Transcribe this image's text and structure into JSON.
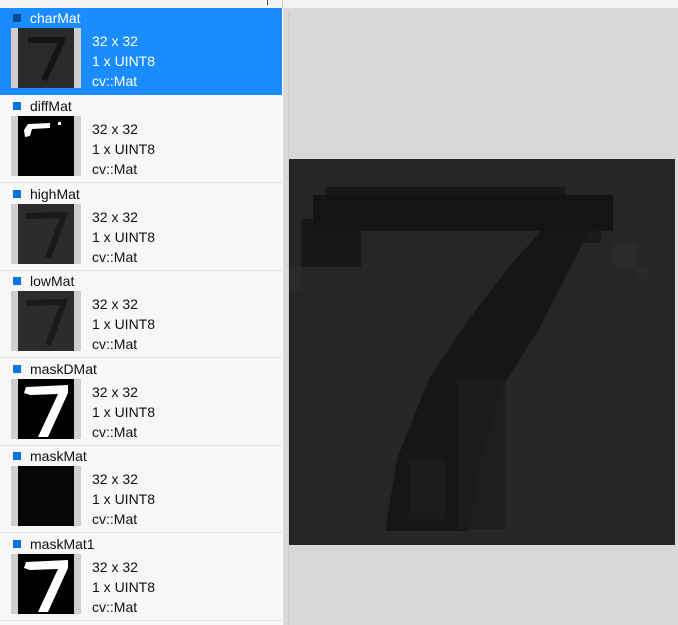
{
  "mats": [
    {
      "name": "charMat",
      "size": "32 x 32",
      "format": "1 x UINT8",
      "type": "cv::Mat",
      "selected": true
    },
    {
      "name": "diffMat",
      "size": "32 x 32",
      "format": "1 x UINT8",
      "type": "cv::Mat",
      "selected": false
    },
    {
      "name": "highMat",
      "size": "32 x 32",
      "format": "1 x UINT8",
      "type": "cv::Mat",
      "selected": false
    },
    {
      "name": "lowMat",
      "size": "32 x 32",
      "format": "1 x UINT8",
      "type": "cv::Mat",
      "selected": false
    },
    {
      "name": "maskDMat",
      "size": "32 x 32",
      "format": "1 x UINT8",
      "type": "cv::Mat",
      "selected": false
    },
    {
      "name": "maskMat",
      "size": "32 x 32",
      "format": "1 x UINT8",
      "type": "cv::Mat",
      "selected": false
    },
    {
      "name": "maskMat1",
      "size": "32 x 32",
      "format": "1 x UINT8",
      "type": "cv::Mat",
      "selected": false
    }
  ],
  "colors": {
    "selection": "#1a8cff",
    "marker": "#0a75e0",
    "viewer_bg": "#d9d9d9",
    "image_dark": "#262626"
  }
}
